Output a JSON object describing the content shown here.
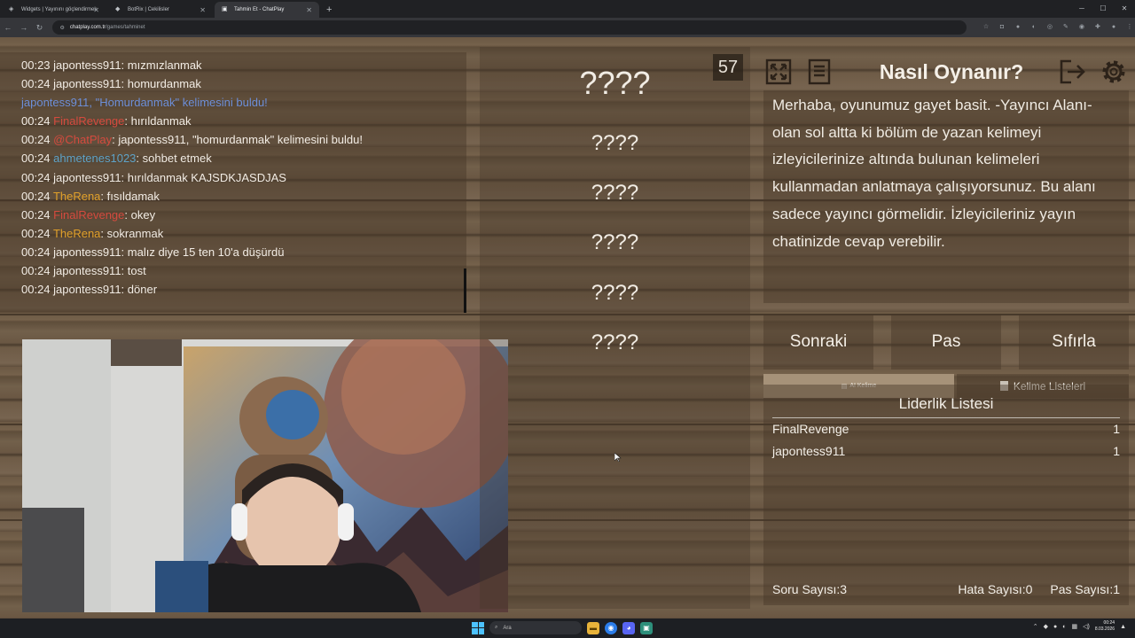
{
  "browser": {
    "tabs": [
      {
        "title": "Widgets | Yayınını göçlendirmek",
        "active": false
      },
      {
        "title": "BotRix | Cekilisler",
        "active": false
      },
      {
        "title": "Tahmin Et - ChatPlay",
        "active": true
      }
    ],
    "url_domain": "chatplay.com.tr",
    "url_path": "/games/tahminet"
  },
  "chat": {
    "messages": [
      {
        "time": "00:23",
        "user": "japontess911",
        "user_color": "plain",
        "text": ": mızmızlanmak"
      },
      {
        "time": "00:24",
        "user": "japontess911",
        "user_color": "plain",
        "text": ": homurdanmak"
      },
      {
        "system": "japontess911, \"Homurdanmak\" kelimesini buldu!"
      },
      {
        "time": "00:24",
        "user": "FinalRevenge",
        "user_color": "red",
        "text": ": hırıldanmak"
      },
      {
        "time": "00:24",
        "user": "@ChatPlay",
        "user_color": "red",
        "text": ": japontess911, \"homurdanmak\" kelimesini buldu!"
      },
      {
        "time": "00:24",
        "user": "ahmetenes1023",
        "user_color": "teal",
        "text": ": sohbet etmek"
      },
      {
        "time": "00:24",
        "user": "japontess911",
        "user_color": "plain",
        "text": ": hırıldanmak KAJSDKJASDJAS"
      },
      {
        "time": "00:24",
        "user": "TheRena",
        "user_color": "orange",
        "text": ": fısıldamak"
      },
      {
        "time": "00:24",
        "user": "FinalRevenge",
        "user_color": "red",
        "text": ": okey"
      },
      {
        "time": "00:24",
        "user": "TheRena",
        "user_color": "orange",
        "text": ": sokranmak"
      },
      {
        "time": "00:24",
        "user": "japontess911",
        "user_color": "plain",
        "text": ": malız diye 15 ten 10'a düşürdü"
      },
      {
        "time": "00:24",
        "user": "japontess911",
        "user_color": "plain",
        "text": ": tost"
      },
      {
        "time": "00:24",
        "user": "japontess911",
        "user_color": "plain",
        "text": ": döner"
      }
    ]
  },
  "game": {
    "timer": "57",
    "main_word": "????",
    "forbidden_words": [
      "????",
      "????",
      "????",
      "????",
      "????"
    ]
  },
  "how_to": {
    "title": "Nasıl Oynanır?",
    "text": "Merhaba, oyunumuz gayet basit. -Yayıncı Alanı- olan sol altta ki bölüm de yazan kelimeyi izleyicilerinize altında bulunan kelimeleri kullanmadan anlatmaya çalışıyorsunuz. Bu alanı sadece yayıncı görmelidir. İzleyicileriniz yayın chatinizde cevap verebilir."
  },
  "controls": {
    "next_label": "Sonraki",
    "pass_label": "Pas",
    "reset_label": "Sıfırla",
    "ai_word_label": "AI Kelime",
    "word_lists_label": "Kelime Listeleri"
  },
  "leaderboard": {
    "title": "Liderlik Listesi",
    "rows": [
      {
        "name": "FinalRevenge",
        "score": "1"
      },
      {
        "name": "japontess911",
        "score": "1"
      }
    ],
    "question_count_label": "Soru Sayısı:3",
    "error_count_label": "Hata Sayısı:0",
    "pass_count_label": "Pas Sayısı:1"
  },
  "taskbar": {
    "search_placeholder": "Ara",
    "clock_time": "00:24",
    "clock_date": "8.03.2026"
  },
  "colors": {
    "username_red": "#d54a3e",
    "username_orange": "#e0a02a",
    "username_teal": "#5ea3c8",
    "system_green": "#39a83e",
    "ai_button": "#a69279"
  }
}
